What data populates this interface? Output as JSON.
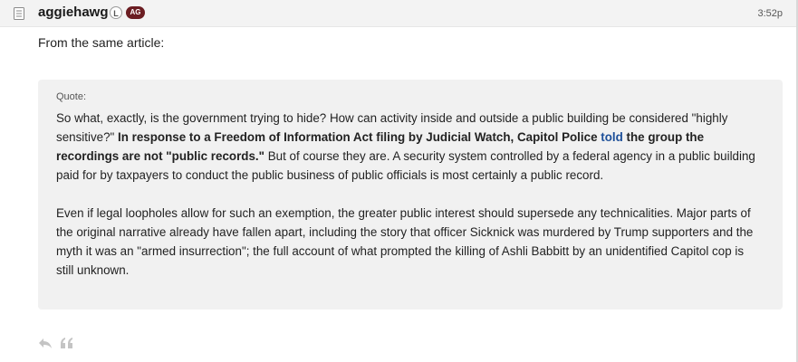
{
  "post": {
    "username": "aggiehawg",
    "badge_l": "L",
    "badge_ag": "AG",
    "timestamp": "3:52p",
    "intro": "From the same article:",
    "quote": {
      "label": "Quote:",
      "p1_a": "So what, exactly, is the government trying to hide? How can activity inside and outside a public building be considered \"highly sensitive?\" ",
      "p1_bold1": "In response to a Freedom of Information Act filing by Judicial Watch, Capitol Police ",
      "p1_link": "told",
      "p1_bold2": " the group the recordings are not \"public records.\"",
      "p1_b": " But of course they are. A security system controlled by a federal agency in a public building paid for by taxpayers to conduct the public business of public officials is most certainly a public record.",
      "p2": "Even if legal loopholes allow for such an exemption, the greater public interest should supersede any technicalities. Major parts of the original narrative already have fallen apart, including the story that officer Sicknick was murdered by Trump supporters and the myth it was an \"armed insurrection\"; the full account of what prompted the killing of Ashli Babbitt by an unidentified Capitol cop is still unknown."
    }
  },
  "icons": {
    "document": "document-icon",
    "reply": "reply-icon",
    "quote": "quote-icon"
  },
  "colors": {
    "header_bg": "#f3f3f3",
    "quote_bg": "#f1f1f1",
    "badge_ag_bg": "#6b1d22",
    "link": "#1d4f99"
  }
}
